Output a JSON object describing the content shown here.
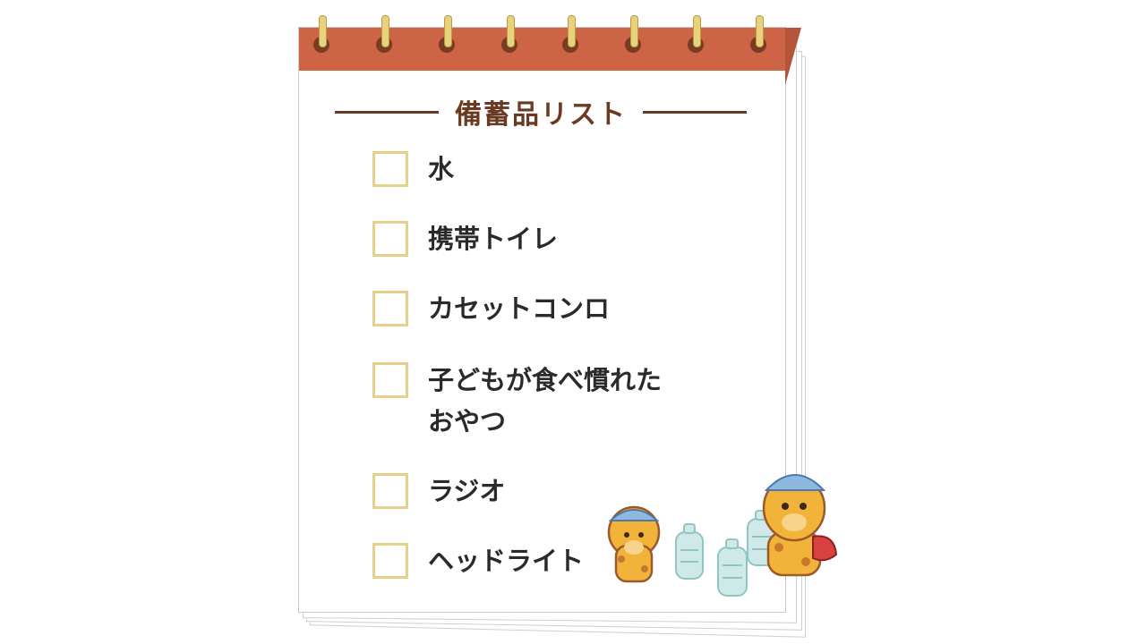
{
  "colors": {
    "header": "#cc6445",
    "ring": "#e9d27d",
    "title": "#6a3a22",
    "checkbox_border": "#e6d18a",
    "text": "#2a2a2a"
  },
  "notepad": {
    "ring_count": 8,
    "title": "備蓄品リスト"
  },
  "checklist": [
    {
      "label": "水",
      "checked": false
    },
    {
      "label": "携帯トイレ",
      "checked": false
    },
    {
      "label": "カセットコンロ",
      "checked": false
    },
    {
      "label": "子どもが食べ慣れたおやつ",
      "line1": "子どもが食べ慣れた",
      "line2": "おやつ",
      "checked": false
    },
    {
      "label": "ラジオ",
      "checked": false
    },
    {
      "label": "ヘッドライト",
      "checked": false
    }
  ],
  "illustration": {
    "icons": [
      "giraffe-mascot-icon",
      "giraffe-mascot-icon",
      "water-bottle-icon"
    ]
  }
}
